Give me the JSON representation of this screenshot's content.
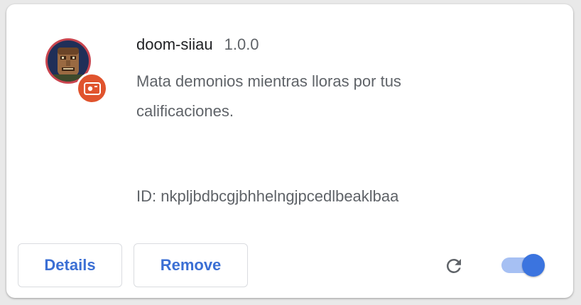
{
  "extension": {
    "name": "doom-siiau",
    "version": "1.0.0",
    "description": "Mata demonios mientras lloras por tus calificaciones.",
    "id_text": "ID: nkpljbdbcgjbhhelngjpcedlbeaklbaa",
    "icon": "doomguy-face-icon",
    "badge_icon": "policy-badge-icon",
    "enabled": true
  },
  "actions": {
    "details_label": "Details",
    "remove_label": "Remove",
    "reload_icon": "reload-icon",
    "toggle_icon": "enable-toggle"
  },
  "colors": {
    "accent": "#3b74df",
    "toggle_track": "#a6c0f3",
    "badge": "#e0542e",
    "icon_ring": "#c9454f"
  }
}
